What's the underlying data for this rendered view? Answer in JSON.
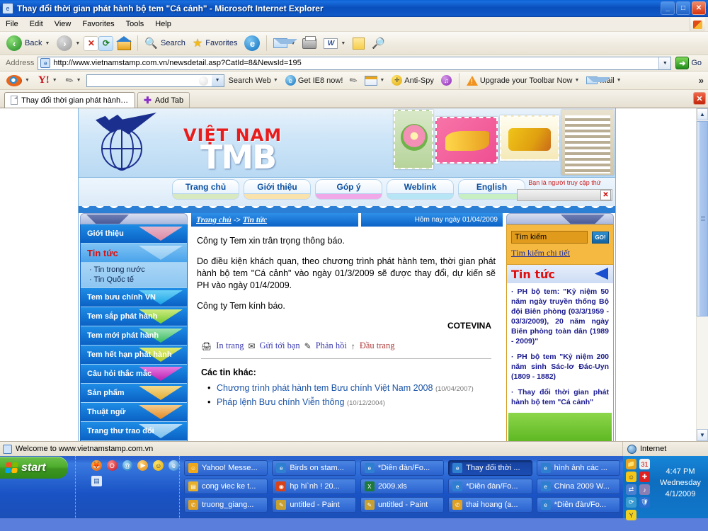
{
  "window": {
    "title": "Thay đổi thời gian phát hành bộ tem \"Cá cảnh\" - Microsoft Internet Explorer",
    "minimize": "_",
    "maximize": "□",
    "close": "✕"
  },
  "menubar": {
    "items": [
      "File",
      "Edit",
      "View",
      "Favorites",
      "Tools",
      "Help"
    ]
  },
  "toolbar": {
    "back": "Back",
    "stop_icon": "stop-icon",
    "refresh_icon": "refresh-icon",
    "home_icon": "home-icon",
    "search": "Search",
    "favorites": "Favorites",
    "media_icon": "media-icon",
    "mail_icon": "mail-icon",
    "print_icon": "print-icon",
    "word_icon": "word-icon",
    "notes_icon": "notes-icon",
    "research_icon": "research-icon"
  },
  "address": {
    "label": "Address",
    "url": "http://www.vietnamstamp.com.vn/newsdetail.asp?CatId=8&NewsId=195",
    "go": "Go"
  },
  "yahoo_toolbar": {
    "search_value": "",
    "search_placeholder": "",
    "search_web": "Search Web",
    "get_ie8": "Get IE8 now!",
    "anti_spy": "Anti-Spy",
    "upgrade": "Upgrade your Toolbar Now",
    "mail": "Mail",
    "overflow": "»"
  },
  "tabs": {
    "active": "Thay đổi thời gian phát hành bộ ...",
    "add_tab": "Add Tab",
    "close": "✕"
  },
  "banner": {
    "brand_vn": "VIỆT NAM",
    "brand_tmb": "TMB"
  },
  "nav": {
    "items": [
      {
        "label": "Trang chủ",
        "color": "#d8e9c0"
      },
      {
        "label": "Giới thiệu",
        "color": "#fae2ac"
      },
      {
        "label": "Góp ý",
        "color": "#f0a8e8"
      },
      {
        "label": "Weblink",
        "color": "#b6e6f6"
      },
      {
        "label": "English",
        "color": "#c8eec4"
      }
    ],
    "visitor_text": "Bạn là người truy cập thứ"
  },
  "sidebar": {
    "items": [
      {
        "label": "Giới thiệu",
        "tri": "linear-gradient(to bottom,#f0b8c8,#e98aa0)",
        "active": false
      },
      {
        "label": "Tin tức",
        "tri": "linear-gradient(to bottom,#bfe2fa,#8fc9f2)",
        "active": true
      },
      {
        "label": "Tem bưu chính VN",
        "tri": "linear-gradient(to bottom,#6fd4f8,#1ea8e8)",
        "active": false
      },
      {
        "label": "Tem sắp phát hành",
        "tri": "linear-gradient(to bottom,#d8f07a,#7cd12a)",
        "active": false
      },
      {
        "label": "Tem mới phát hành",
        "tri": "linear-gradient(to bottom,#a8e8b0,#3bc05a)",
        "active": false
      },
      {
        "label": "Tem hết hạn phát hành",
        "tri": "linear-gradient(to bottom,#e8f06a,#b9d020)",
        "active": false
      },
      {
        "label": "Câu hỏi thắc mắc",
        "tri": "linear-gradient(to bottom,#f07ae0,#c41ab0)",
        "active": false
      },
      {
        "label": "Sản phẩm",
        "tri": "linear-gradient(to bottom,#ffe08a,#f0ae2a)",
        "active": false
      },
      {
        "label": "Thuật ngữ",
        "tri": "linear-gradient(to bottom,#ffd08a,#f08a1a)",
        "active": false
      },
      {
        "label": "Trang thư trao đổi",
        "tri": "linear-gradient(to bottom,#bfe2fa,#7fc4ee)",
        "active": false
      }
    ],
    "subitems": [
      "· Tin trong nước",
      "· Tin Quốc tế"
    ]
  },
  "breadcrumb": {
    "home": "Trang chủ",
    "arrow": "->",
    "section": "Tin tức",
    "today": "Hôm nay ngày 01/04/2009"
  },
  "article": {
    "p1": "Công ty Tem xin trân trọng thông báo.",
    "p2": "Do điều kiện khách quan, theo chương trình phát hành tem, thời gian phát hành bộ tem \"Cá cảnh\" vào ngày 01/3/2009 sẽ được thay đổi, dự kiến sẽ PH vào ngày 01/4/2009.",
    "p3": "Công ty Tem kính báo.",
    "signature": "COTEVINA"
  },
  "actions": {
    "print": "In trang",
    "send": "Gửi tới bạn",
    "feedback": "Phản hồi",
    "top": "Đầu trang",
    "print_icon": "printer-icon",
    "mail_icon": "envelope-icon",
    "feedback_icon": "pencil-icon",
    "top_icon": "arrow-up-icon"
  },
  "other_news": {
    "heading": "Các tin khác:",
    "items": [
      {
        "title": "Chương trình phát hành tem Bưu chính Việt Nam 2008",
        "date": "(10/04/2007)"
      },
      {
        "title": "Pháp lệnh Bưu chính Viễn thông",
        "date": "(10/12/2004)"
      }
    ]
  },
  "search_panel": {
    "value": "Tìm kiếm",
    "go": "GO!",
    "detail_link": "Tìm kiếm chi tiết"
  },
  "news_panel": {
    "heading": "Tin tức",
    "items": [
      "· PH bộ tem: \"Kỷ niệm 50 năm ngày truyền thống Bộ đội Biên phòng (03/3/1959 - 03/3/2009), 20 năm ngày Biên phòng toàn dân (1989 - 2009)\"",
      "· PH bộ tem \"Kỷ niệm 200 năm sinh Sác-lơ Đác-Uyn (1809 - 1882)",
      "· Thay đổi thời gian phát hành bộ tem \"Cá cảnh\""
    ]
  },
  "statusbar": {
    "message": "Welcome to www.vietnamstamp.com.vn",
    "zone": "Internet"
  },
  "taskbar": {
    "start": "start",
    "tasks": [
      [
        {
          "label": "Yahoo! Messe...",
          "icon": "#f0a81a",
          "glyph": "☺",
          "selected": false
        },
        {
          "label": "Birds on stam...",
          "icon": "#2f7fd0",
          "glyph": "e",
          "selected": false
        },
        {
          "label": "*Diễn đàn/Fo...",
          "icon": "#2f7fd0",
          "glyph": "e",
          "selected": false
        },
        {
          "label": "Thay đổi thời ...",
          "icon": "#2f7fd0",
          "glyph": "e",
          "selected": true
        },
        {
          "label": "hình ảnh các ...",
          "icon": "#2f7fd0",
          "glyph": "e",
          "selected": false
        }
      ],
      [
        {
          "label": "cong viec ke t...",
          "icon": "#e8b02a",
          "glyph": "▤",
          "selected": false
        },
        {
          "label": "hp hi`nh ! 20...",
          "icon": "#d8431a",
          "glyph": "◉",
          "selected": false
        },
        {
          "label": "2009.xls",
          "icon": "#1d7a3a",
          "glyph": "X",
          "selected": false
        },
        {
          "label": "*Diễn đàn/Fo...",
          "icon": "#2f7fd0",
          "glyph": "e",
          "selected": false
        },
        {
          "label": "China 2009 W...",
          "icon": "#2f7fd0",
          "glyph": "e",
          "selected": false
        }
      ],
      [
        {
          "label": "truong_giang...",
          "icon": "#e0a020",
          "glyph": "✆",
          "selected": false
        },
        {
          "label": "untitled - Paint",
          "icon": "#c8a030",
          "glyph": "✎",
          "selected": false
        },
        {
          "label": "untitled - Paint",
          "icon": "#c8a030",
          "glyph": "✎",
          "selected": false
        },
        {
          "label": "thai hoang (a...",
          "icon": "#e0a020",
          "glyph": "✆",
          "selected": false
        },
        {
          "label": "*Diễn đàn/Fo...",
          "icon": "#2f7fd0",
          "glyph": "e",
          "selected": false
        }
      ]
    ],
    "clock_time": "4:47 PM",
    "clock_day": "Wednesday",
    "clock_date": "4/1/2009"
  }
}
